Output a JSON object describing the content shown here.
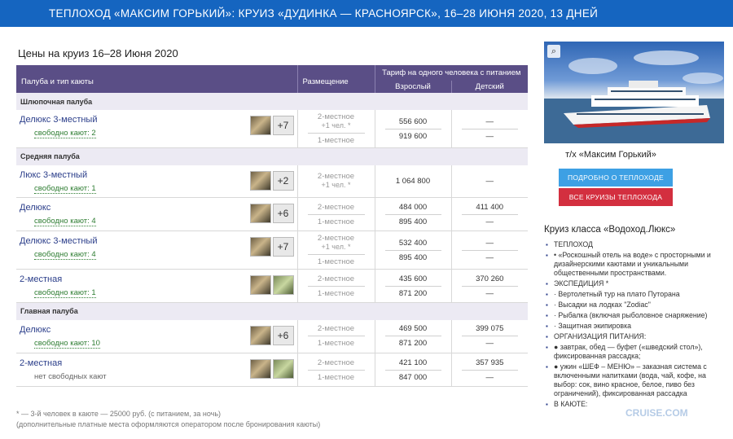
{
  "header": {
    "title": "ТЕПЛОХОД «МАКСИМ ГОРЬКИЙ»: КРУИЗ «ДУДИНКА — КРАСНОЯРСК», 16–28 ИЮНЯ 2020, 13  ДНЕЙ"
  },
  "page_title": "Цены на круиз 16–28 Июня 2020",
  "table": {
    "col_deck": "Палуба и тип каюты",
    "col_place": "Размещение",
    "col_tariff": "Тариф на одного человека с питанием",
    "col_adult": "Взрослый",
    "col_child": "Детский",
    "decks": [
      {
        "name": "Шлюпочная палуба",
        "cabins": [
          {
            "name": "Делюкс 3-местный",
            "free": "свободно кают: 2",
            "more": "+7",
            "places": [
              {
                "t": "2-местное",
                "s": "+1 чел. *"
              },
              {
                "t": "1-местное",
                "s": ""
              }
            ],
            "adult": [
              "556 600",
              "919 600"
            ],
            "child": [
              "—",
              "—"
            ]
          }
        ]
      },
      {
        "name": "Средняя палуба",
        "cabins": [
          {
            "name": "Люкс 3-местный",
            "free": "свободно кают: 1",
            "more": "+2",
            "places": [
              {
                "t": "2-местное",
                "s": "+1 чел. *"
              }
            ],
            "adult": [
              "1 064 800"
            ],
            "child": [
              "—"
            ]
          },
          {
            "name": "Делюкс",
            "free": "свободно кают: 4",
            "more": "+6",
            "places": [
              {
                "t": "2-местное",
                "s": ""
              },
              {
                "t": "1-местное",
                "s": ""
              }
            ],
            "adult": [
              "484 000",
              "895 400"
            ],
            "child": [
              "411 400",
              "—"
            ]
          },
          {
            "name": "Делюкс 3-местный",
            "free": "свободно кают: 4",
            "more": "+7",
            "places": [
              {
                "t": "2-местное",
                "s": "+1 чел. *"
              },
              {
                "t": "1-местное",
                "s": ""
              }
            ],
            "adult": [
              "532 400",
              "895 400"
            ],
            "child": [
              "—",
              "—"
            ]
          },
          {
            "name": "2-местная",
            "free": "свободно кают: 1",
            "more": "",
            "places": [
              {
                "t": "2-местное",
                "s": ""
              },
              {
                "t": "1-местное",
                "s": ""
              }
            ],
            "adult": [
              "435 600",
              "871 200"
            ],
            "child": [
              "370 260",
              "—"
            ]
          }
        ]
      },
      {
        "name": "Главная палуба",
        "cabins": [
          {
            "name": "Делюкс",
            "free": "свободно кают: 10",
            "more": "+6",
            "places": [
              {
                "t": "2-местное",
                "s": ""
              },
              {
                "t": "1-местное",
                "s": ""
              }
            ],
            "adult": [
              "469 500",
              "871 200"
            ],
            "child": [
              "399 075",
              "—"
            ]
          },
          {
            "name": "2-местная",
            "free": "нет свободных кают",
            "more": "",
            "places": [
              {
                "t": "2-местное",
                "s": ""
              },
              {
                "t": "1-местное",
                "s": ""
              }
            ],
            "adult": [
              "421 100",
              "847 000"
            ],
            "child": [
              "357 935",
              "—"
            ]
          }
        ]
      }
    ]
  },
  "footnote": {
    "line1": "* — 3-й человек в каюте — 25000 руб. (с питанием, за ночь)",
    "line2": "(дополнительные платные места оформляются оператором после бронирования каюты)"
  },
  "sidebar": {
    "ship_name": "т/х «Максим Горький»",
    "btn_about": "ПОДРОБНО О ТЕПЛОХОДЕ",
    "btn_all": "ВСЕ КРУИЗЫ ТЕПЛОХОДА",
    "class_title": "Круиз класса «Водоход.Люкс»",
    "features": [
      "ТЕПЛОХОД",
      "• «Роскошный отель на воде» с просторными и дизайнерскими каютами и уникальными общественными пространствами.",
      "ЭКСПЕДИЦИЯ *",
      "· Вертолетный тур на плато Путорана",
      "· Высадки на лодках \"Zodiac\"",
      "· Рыбалка (включая рыболовное снаряжение)",
      "· Защитная экипировка",
      "ОРГАНИЗАЦИЯ ПИТАНИЯ:",
      "● завтрак, обед — буфет («шведский стол»), фиксированная рассадка;",
      "● ужин «ШЕФ – МЕНЮ» – заказная система с включенными напитками (вода, чай, кофе, на выбор: сок, вино красное, белое, пиво без ограничений), фиксированная рассадка",
      "В КАЮТЕ:"
    ],
    "watermark": "CRUISE.COM"
  }
}
